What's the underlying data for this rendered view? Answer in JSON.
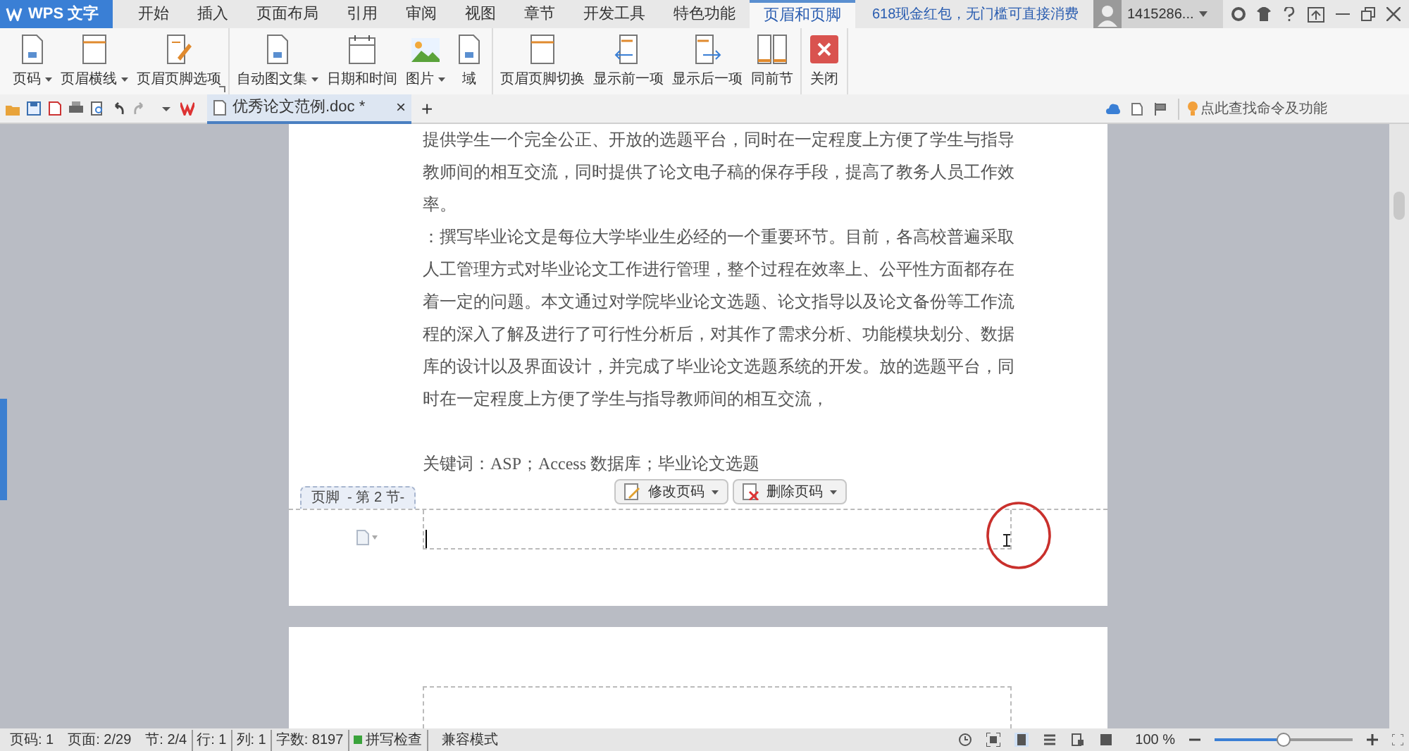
{
  "app_menu": {
    "label": "WPS 文字"
  },
  "tabs": [
    {
      "label": "开始",
      "selected": false
    },
    {
      "label": "插入",
      "selected": false
    },
    {
      "label": "页面布局",
      "selected": false
    },
    {
      "label": "引用",
      "selected": false
    },
    {
      "label": "审阅",
      "selected": false
    },
    {
      "label": "视图",
      "selected": false
    },
    {
      "label": "章节",
      "selected": false
    },
    {
      "label": "开发工具",
      "selected": false
    },
    {
      "label": "特色功能",
      "selected": false
    },
    {
      "label": "页眉和页脚",
      "selected": true
    }
  ],
  "promo": "618现金红包，无门槛可直接消费",
  "user": {
    "name": "1415286..."
  },
  "ribbon_groups": [
    [
      {
        "label": "页码",
        "kind": "doc",
        "dropdown": true
      },
      {
        "label": "页眉横线",
        "kind": "frame",
        "dropdown": true
      },
      {
        "label": "页眉页脚选项",
        "kind": "edit",
        "dropdown": false
      }
    ],
    [
      {
        "label": "自动图文集",
        "kind": "doc",
        "dropdown": true
      },
      {
        "label": "日期和时间",
        "kind": "calendar",
        "dropdown": false
      },
      {
        "label": "图片",
        "kind": "picture",
        "dropdown": true
      },
      {
        "label": "域",
        "kind": "doc",
        "dropdown": false
      }
    ],
    [
      {
        "label": "页眉页脚切换",
        "kind": "frame",
        "dropdown": false
      },
      {
        "label": "显示前一项",
        "kind": "prev",
        "dropdown": false
      },
      {
        "label": "显示后一项",
        "kind": "next",
        "dropdown": false
      },
      {
        "label": "同前节",
        "kind": "pages",
        "dropdown": false
      }
    ],
    [
      {
        "label": "关闭",
        "kind": "close",
        "dropdown": false
      }
    ]
  ],
  "document_tab": {
    "title": "优秀论文范例.doc *",
    "close": "×",
    "new": "+"
  },
  "command_search": {
    "placeholder": "点此查找命令及功能"
  },
  "page_paragraphs": [
    "提供学生一个完全公正、开放的选题平台，同时在一定程度上方便了学生与指导教师间的相互交流，同时提供了论文电子稿的保存手段，提高了教务人员工作效率。",
    "：撰写毕业论文是每位大学毕业生必经的一个重要环节。目前，各高校普遍采取人工管理方式对毕业论文工作进行管理，整个过程在效率上、公平性方面都存在着一定的问题。本文通过对学院毕业论文选题、论文指导以及论文备份等工作流程的深入了解及进行了可行性分析后，对其作了需求分析、功能模块划分、数据库的设计以及界面设计，并完成了毕业论文选题系统的开发。放的选题平台，同时在一定程度上方便了学生与指导教师间的相互交流，"
  ],
  "keywords": "关键词：ASP；Access 数据库；毕业论文选题",
  "footer": {
    "label": "页脚  - 第 2 节-",
    "buttons": [
      "修改页码",
      "删除页码"
    ]
  },
  "status_bar": {
    "items": [
      "页码: 1",
      "页面: 2/29",
      "节: 2/4",
      "行: 1",
      "列: 1",
      "字数: 8197"
    ],
    "spell_check": "拼写检查",
    "mode": "兼容模式",
    "zoom": "100 %",
    "zoom_slider": {
      "level": 0.5
    }
  }
}
